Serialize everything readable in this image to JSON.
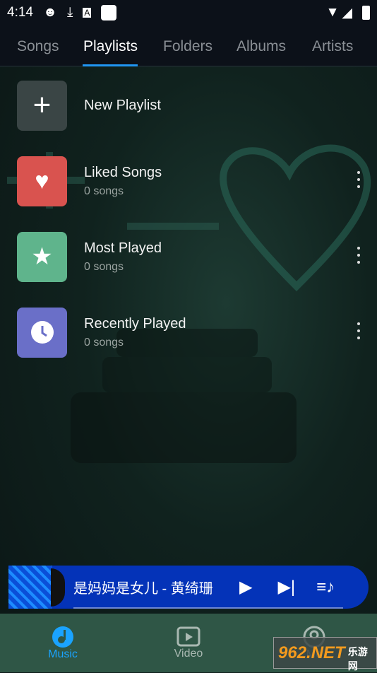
{
  "status": {
    "time": "4:14"
  },
  "tabs": [
    {
      "label": "Songs"
    },
    {
      "label": "Playlists",
      "active": true
    },
    {
      "label": "Folders"
    },
    {
      "label": "Albums"
    },
    {
      "label": "Artists"
    }
  ],
  "new_playlist": {
    "label": "New Playlist",
    "icon": "plus-icon"
  },
  "playlists": [
    {
      "title": "Liked Songs",
      "count": "0 songs",
      "icon": "heart-icon",
      "color": "#d9534f"
    },
    {
      "title": "Most Played",
      "count": "0 songs",
      "icon": "star-icon",
      "color": "#5fb48c"
    },
    {
      "title": "Recently Played",
      "count": "0 songs",
      "icon": "clock-icon",
      "color": "#6a6fc8"
    }
  ],
  "player": {
    "title": "是妈妈是女儿 - 黄绮珊",
    "accent": "#0433b8"
  },
  "bottom_nav": [
    {
      "label": "Music",
      "active": true
    },
    {
      "label": "Video"
    },
    {
      "label": "Me"
    }
  ],
  "watermark": {
    "text": "962.NET",
    "sub": "乐游网"
  },
  "colors": {
    "accent": "#2196f3",
    "active_nav": "#1aa3ff"
  }
}
